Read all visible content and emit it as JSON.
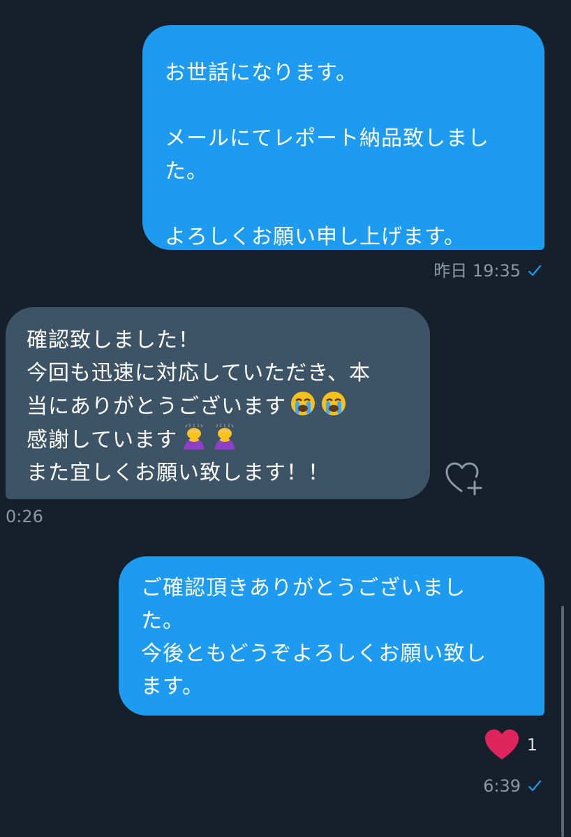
{
  "messages": [
    {
      "direction": "outgoing",
      "lines": [
        "お世話になります。",
        "",
        "メールにてレポート納品致しまし",
        "た。",
        "",
        "よろしくお願い申し上げます。"
      ],
      "time": "昨日 19:35",
      "read_icon": "check-icon"
    },
    {
      "direction": "incoming",
      "lines": [
        "確認致しました！",
        "今回も迅速に対応していただき、本",
        "当にありがとうございます",
        "感謝しています",
        "また宜しくお願い致します！！"
      ],
      "emojis": [
        "loudly-crying-face-icon",
        "loudly-crying-face-icon",
        "person-bowing-icon",
        "person-bowing-icon"
      ],
      "time": "0:26",
      "like_icon": "heart-plus-icon"
    },
    {
      "direction": "outgoing",
      "lines": [
        "ご確認頂きありがとうございまし",
        "た。",
        "今後ともどうぞよろしくお願い致し",
        "ます。"
      ],
      "reaction": {
        "icon": "red-heart-icon",
        "count": "1"
      },
      "time": "6:39",
      "read_icon": "check-icon"
    }
  ],
  "colors": {
    "background": "#15202b",
    "outgoing_bubble": "#1d9bf0",
    "incoming_bubble": "#3d5466",
    "meta_text": "#8b98a5",
    "read_check": "#1d9bf0",
    "reaction_heart": "#e0245e"
  }
}
